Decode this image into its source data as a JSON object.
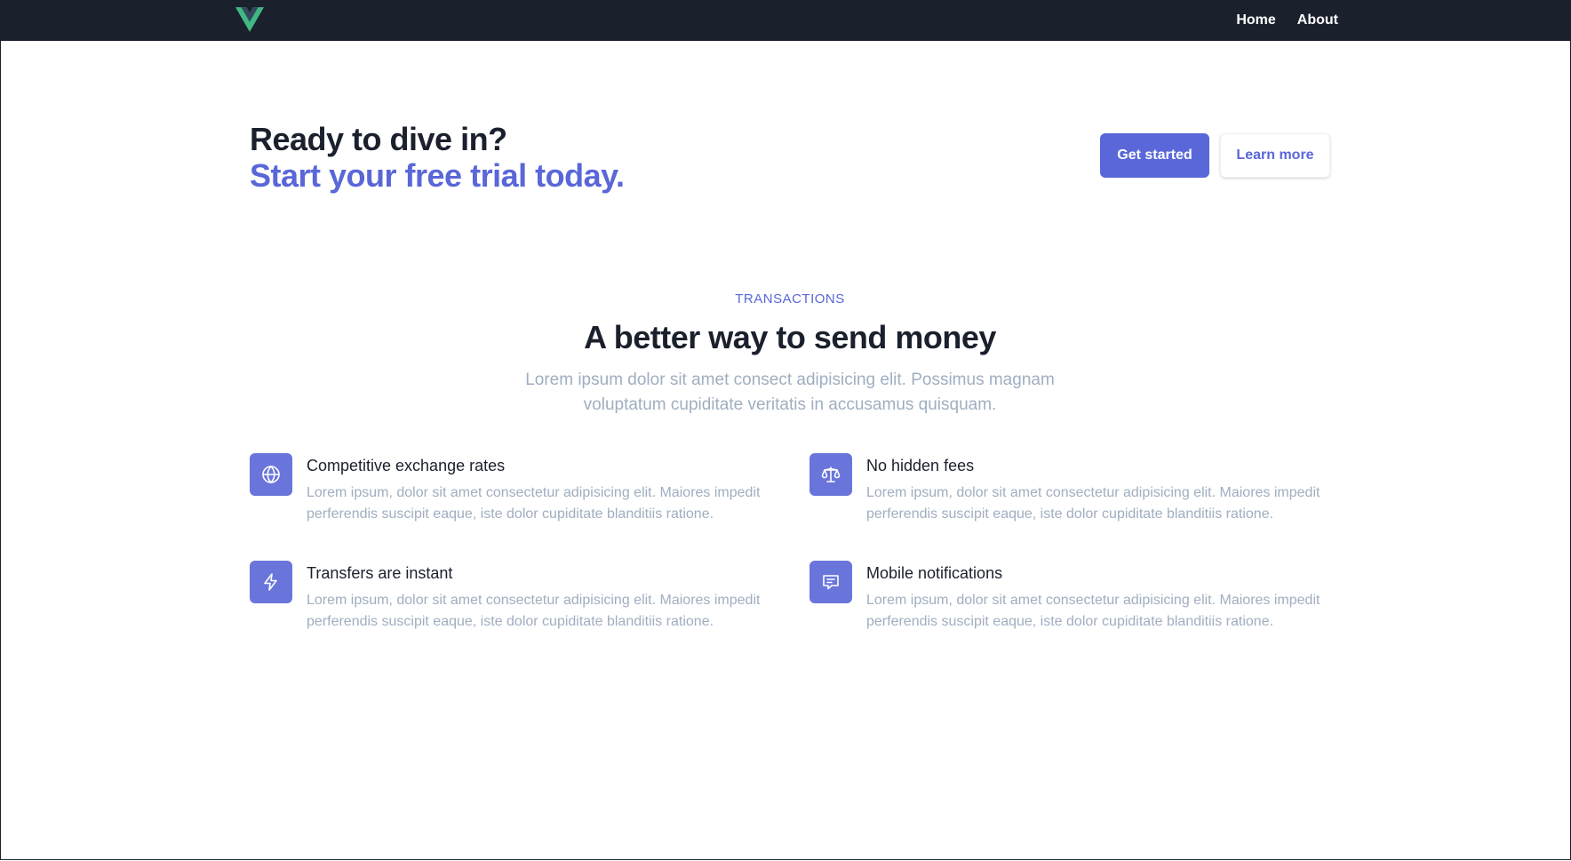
{
  "nav": {
    "links": [
      "Home",
      "About"
    ]
  },
  "cta": {
    "title": "Ready to dive in?",
    "subtitle": "Start your free trial today.",
    "primary_button": "Get started",
    "secondary_button": "Learn more"
  },
  "features": {
    "eyebrow": "TRANSACTIONS",
    "title": "A better way to send money",
    "subtitle": "Lorem ipsum dolor sit amet consect adipisicing elit. Possimus magnam voluptatum cupiditate veritatis in accusamus quisquam.",
    "items": [
      {
        "title": "Competitive exchange rates",
        "description": "Lorem ipsum, dolor sit amet consectetur adipisicing elit. Maiores impedit perferendis suscipit eaque, iste dolor cupiditate blanditiis ratione.",
        "icon": "globe-icon"
      },
      {
        "title": "No hidden fees",
        "description": "Lorem ipsum, dolor sit amet consectetur adipisicing elit. Maiores impedit perferendis suscipit eaque, iste dolor cupiditate blanditiis ratione.",
        "icon": "scale-icon"
      },
      {
        "title": "Transfers are instant",
        "description": "Lorem ipsum, dolor sit amet consectetur adipisicing elit. Maiores impedit perferendis suscipit eaque, iste dolor cupiditate blanditiis ratione.",
        "icon": "lightning-icon"
      },
      {
        "title": "Mobile notifications",
        "description": "Lorem ipsum, dolor sit amet consectetur adipisicing elit. Maiores impedit perferendis suscipit eaque, iste dolor cupiditate blanditiis ratione.",
        "icon": "chat-icon"
      }
    ]
  },
  "colors": {
    "navbar_bg": "#1a202c",
    "accent": "#5a67d8",
    "muted_text": "#a0aec0",
    "logo_green": "#41b883",
    "logo_dark": "#35495e"
  }
}
